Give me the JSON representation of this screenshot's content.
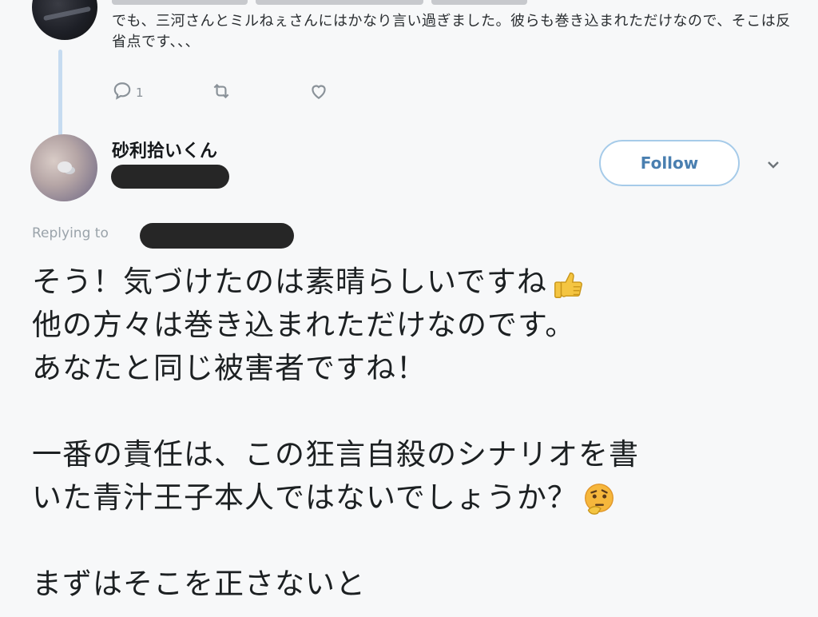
{
  "previous_tweet": {
    "text": "でも、三河さんとミルねぇさんにはかなり言い過ぎました。彼らも巻き込まれただけなので、そこは反省点です、、、",
    "reply_count": "1",
    "icons": [
      "reply-icon",
      "retweet-icon",
      "like-icon"
    ]
  },
  "tweet": {
    "display_name": "砂利拾いくん",
    "follow_label": "Follow",
    "replying_label": "Replying to",
    "lines": [
      "そう！気づけたのは素晴らしいですね",
      "他の方々は巻き込まれただけなのです。",
      "あなたと同じ被害者ですね！",
      "",
      "一番の責任は、この狂言自殺のシナリオを書",
      "いた青汁王子本人ではないでしょうか？",
      "",
      "まずはそこを正さないと"
    ],
    "emojis": {
      "line_0": "thumbs-up",
      "line_5": "thinking-face"
    }
  },
  "colors": {
    "accent": "#4a7fb0",
    "follow_border": "#a6cbe9",
    "thread_line": "#c6dbf0",
    "muted": "#8a9299"
  }
}
